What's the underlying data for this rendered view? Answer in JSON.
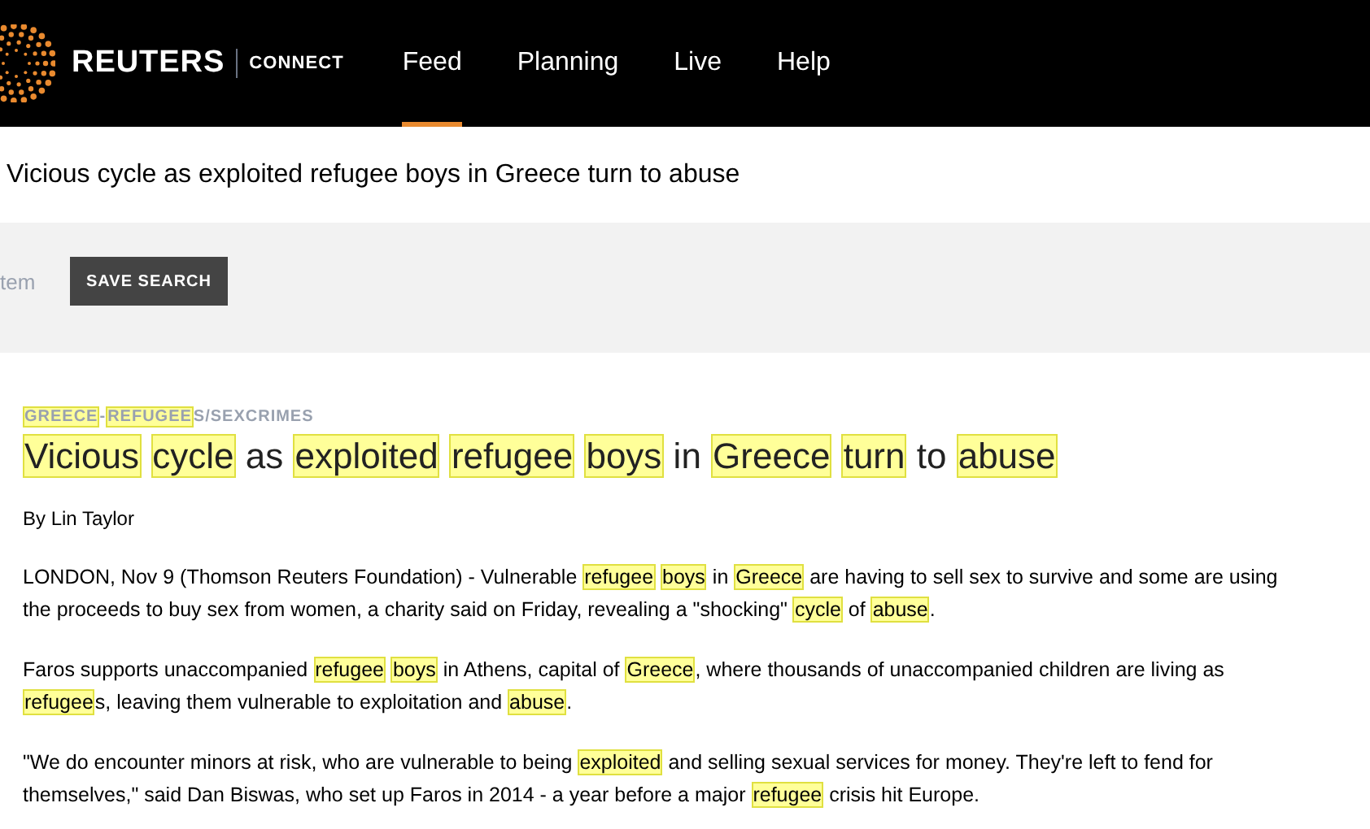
{
  "header": {
    "brand": "REUTERS",
    "product": "CONNECT",
    "nav": [
      {
        "label": "Feed",
        "selected": true
      },
      {
        "label": "Planning",
        "selected": false
      },
      {
        "label": "Live",
        "selected": false
      },
      {
        "label": "Help",
        "selected": false
      }
    ]
  },
  "page_title": "Vicious cycle as exploited refugee boys in Greece turn to abuse",
  "search": {
    "placeholder": "tem",
    "button": "SAVE SEARCH"
  },
  "article": {
    "slug": [
      {
        "text": "GREECE",
        "highlighted": true
      },
      {
        "text": "-",
        "highlighted": false
      },
      {
        "text": "REFUGEE",
        "highlighted": true
      },
      {
        "text": "S/SEXCRIMES",
        "highlighted": false
      }
    ],
    "headline": [
      {
        "text": "Vicious",
        "highlighted": true
      },
      {
        "text": "cycle",
        "highlighted": true
      },
      {
        "text": " as ",
        "highlighted": false
      },
      {
        "text": "exploited",
        "highlighted": true
      },
      {
        "text": "refugee",
        "highlighted": true
      },
      {
        "text": "boys",
        "highlighted": true
      },
      {
        "text": " in ",
        "highlighted": false
      },
      {
        "text": "Greece",
        "highlighted": true
      },
      {
        "text": "turn",
        "highlighted": true
      },
      {
        "text": " to ",
        "highlighted": false
      },
      {
        "text": "abuse",
        "highlighted": true
      }
    ],
    "byline": "By Lin Taylor",
    "paragraphs": [
      [
        {
          "text": "LONDON, Nov 9 (Thomson Reuters Foundation) - Vulnerable ",
          "highlighted": false
        },
        {
          "text": "refugee",
          "highlighted": true
        },
        {
          "text": "boys",
          "highlighted": true
        },
        {
          "text": " in ",
          "highlighted": false
        },
        {
          "text": "Greece",
          "highlighted": true
        },
        {
          "text": " are having to sell sex to survive and some are using the proceeds to buy sex from women, a charity said on Friday, revealing a \"shocking\" ",
          "highlighted": false
        },
        {
          "text": "cycle",
          "highlighted": true
        },
        {
          "text": " of ",
          "highlighted": false
        },
        {
          "text": "abuse",
          "highlighted": true
        },
        {
          "text": ".",
          "highlighted": false
        }
      ],
      [
        {
          "text": "Faros supports unaccompanied ",
          "highlighted": false
        },
        {
          "text": "refugee",
          "highlighted": true
        },
        {
          "text": "boys",
          "highlighted": true
        },
        {
          "text": " in Athens, capital of ",
          "highlighted": false
        },
        {
          "text": "Greece",
          "highlighted": true
        },
        {
          "text": ", where thousands of unaccompanied children are living as ",
          "highlighted": false
        },
        {
          "text": "refugee",
          "highlighted": true
        },
        {
          "text": "s, leaving them vulnerable to exploitation and ",
          "highlighted": false
        },
        {
          "text": "abuse",
          "highlighted": true
        },
        {
          "text": ".",
          "highlighted": false
        }
      ],
      [
        {
          "text": "\"We do encounter minors at risk, who are vulnerable to being ",
          "highlighted": false
        },
        {
          "text": "exploited",
          "highlighted": true
        },
        {
          "text": " and selling sexual services for money. They're left to fend for themselves,\" said Dan Biswas, who set up Faros in 2014 - a year before a major ",
          "highlighted": false
        },
        {
          "text": "refugee",
          "highlighted": true
        },
        {
          "text": " crisis hit Europe.",
          "highlighted": false
        }
      ]
    ]
  }
}
